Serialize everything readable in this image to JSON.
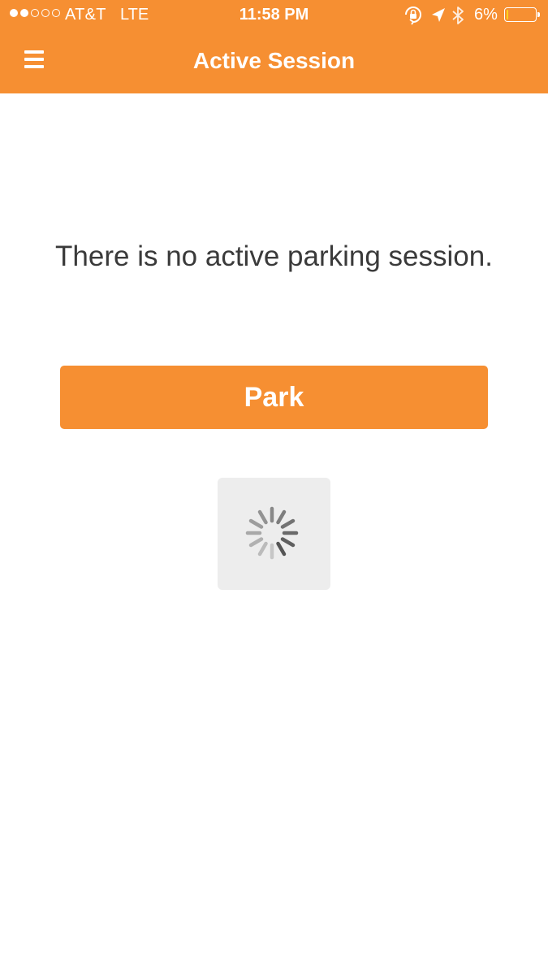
{
  "status_bar": {
    "carrier": "AT&T",
    "network": "LTE",
    "time": "11:58 PM",
    "battery_percent": "6%",
    "battery_level": 0.06,
    "signal_bars_filled": 2,
    "signal_bars_total": 5,
    "icons": [
      "orientation-lock-icon",
      "location-arrow-icon",
      "bluetooth-icon",
      "battery-icon"
    ]
  },
  "nav": {
    "title": "Active Session",
    "menu_icon": "hamburger-menu-icon"
  },
  "main": {
    "message": "There is no active parking session.",
    "park_button_label": "Park",
    "loading_indicator": "spinner-icon"
  },
  "colors": {
    "accent": "#f68f32",
    "text": "#3a3a3a",
    "background": "#ffffff",
    "spinner_background": "#ededed",
    "battery_low": "#ffd21c"
  }
}
